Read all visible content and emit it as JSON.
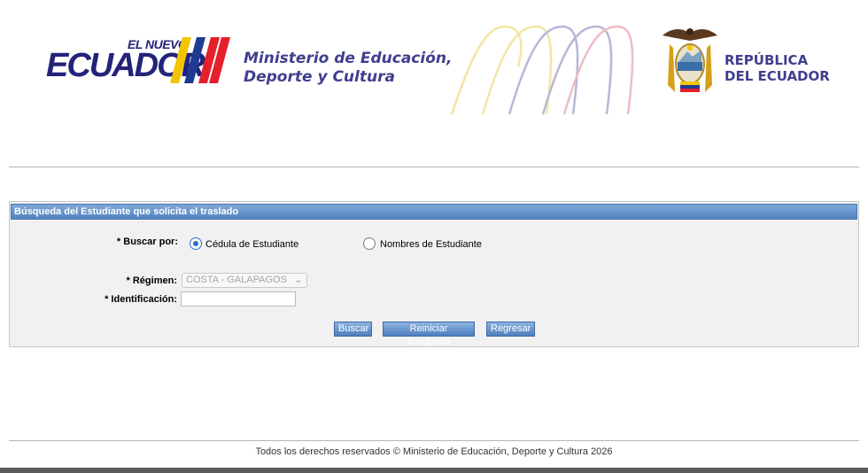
{
  "header": {
    "brand_small": "EL NUEVO",
    "brand_big": "ECUADOR",
    "ministry_line1": "Ministerio de Educación,",
    "ministry_line2": "Deporte y Cultura",
    "republica_line1": "REPÚBLICA",
    "republica_line2": "DEL ECUADOR",
    "colors": {
      "brand_navy": "#23237a",
      "ministry_text": "#3f3f8f",
      "yellow": "#f2c500",
      "blue": "#1f3a93",
      "red": "#e4202d"
    }
  },
  "panel": {
    "title": "Búsqueda del Estudiante que solicita el traslado",
    "buscar_por_label": "* Buscar por:",
    "options": [
      {
        "label": "Cédula de Estudiante",
        "selected": true
      },
      {
        "label": "Nombres de Estudiante",
        "selected": false
      }
    ],
    "regimen_label": "* Régimen:",
    "regimen_value": "COSTA - GALAPAGOS",
    "identificacion_label": "* Identificación:",
    "identificacion_value": "",
    "buttons": {
      "buscar": "Buscar",
      "reiniciar": "Reiniciar búsqueda",
      "regresar": "Regresar"
    }
  },
  "footer": {
    "text": "Todos los derechos reservados © Ministerio de Educación, Deporte y Cultura 2026"
  },
  "icons": {
    "chevron": "chevron-down-icon",
    "coat_of_arms": "coat-of-arms-icon"
  }
}
